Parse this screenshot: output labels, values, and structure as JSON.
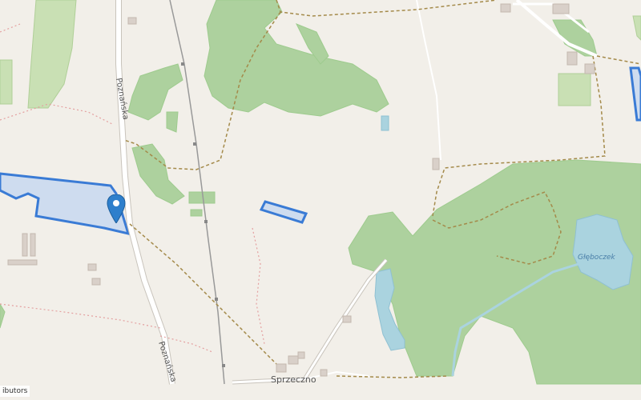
{
  "map": {
    "labels": {
      "road_north": "Poznańska",
      "road_south": "Poznańska",
      "village": "Sprzeczno",
      "lake": "Głęboczek"
    },
    "attribution": "ibutors",
    "colors": {
      "background": "#f2efe9",
      "forest": "#add19e",
      "water": "#aad3df",
      "highlight_fill": "#c8d8f0",
      "highlight_stroke": "#3a7bd5",
      "marker": "#2e7fcc"
    },
    "icons": [
      "map-marker-icon"
    ]
  }
}
